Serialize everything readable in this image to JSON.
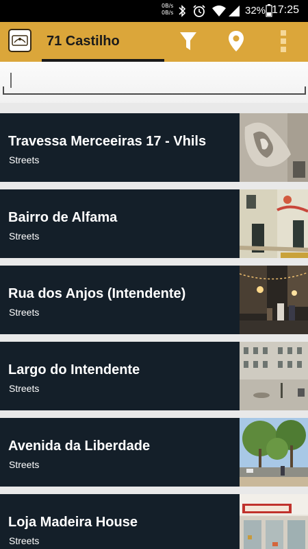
{
  "status": {
    "net_up": "0B/s",
    "net_down": "0B/s",
    "battery": "32%",
    "time": "17:25"
  },
  "toolbar": {
    "title": "71 Castilho",
    "logo_icon": "brand-logo-icon",
    "filter_icon": "filter-icon",
    "location_icon": "map-pin-icon",
    "menu_icon": "overflow-menu-icon"
  },
  "search": {
    "value": "",
    "placeholder": ""
  },
  "places": [
    {
      "name": "Travessa Merceeiras 17 - Vhils",
      "category": "Streets",
      "thumb": "street-art-wall"
    },
    {
      "name": "Bairro de Alfama",
      "category": "Streets",
      "thumb": "alfama-building"
    },
    {
      "name": "Rua dos Anjos (Intendente)",
      "category": "Streets",
      "thumb": "night-street"
    },
    {
      "name": "Largo do Intendente",
      "category": "Streets",
      "thumb": "square-facade"
    },
    {
      "name": "Avenida da Liberdade",
      "category": "Streets",
      "thumb": "tree-avenue"
    },
    {
      "name": "Loja Madeira House",
      "category": "Streets",
      "thumb": "shop-front"
    }
  ],
  "colors": {
    "appbar": "#dba63a",
    "card": "#141f29",
    "background": "#e9e9e9"
  }
}
